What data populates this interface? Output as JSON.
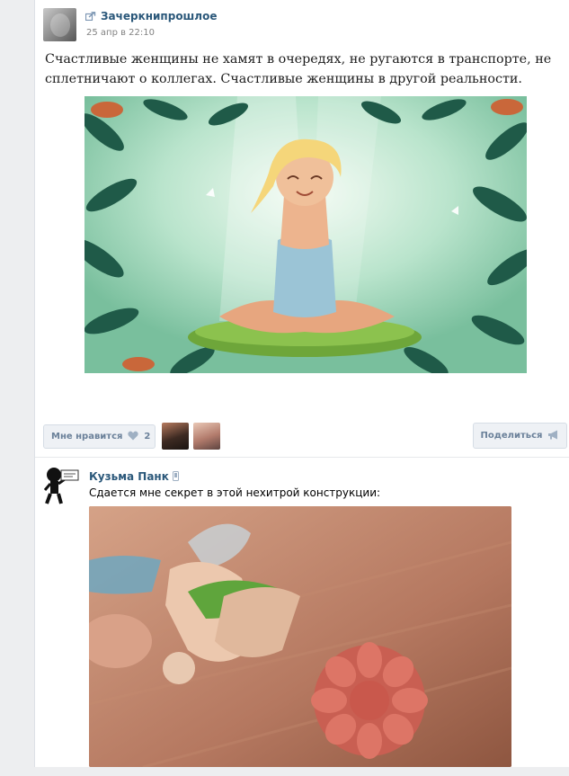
{
  "post": {
    "author": "Зачеркнипрошлое",
    "date": "25 апр в 22:10",
    "text": "Счастливые женщины не хамят в очередях, не ругаются в транспорте, не сплетничают о коллегах. Счастливые женщины в другой реальности.",
    "icons": {
      "repost": "repost-icon",
      "heart": "heart-icon",
      "megaphone": "megaphone-icon"
    }
  },
  "actions": {
    "like_label": "Мне нравится",
    "like_count": "2",
    "share_label": "Поделиться"
  },
  "comment": {
    "author": "Кузьма Панк",
    "text": "Сдается мне секрет в этой нехитрой конструкции:",
    "icons": {
      "mobile": "mobile-icon"
    }
  },
  "colors": {
    "link": "#2b587a",
    "button_text": "#6a8099",
    "button_bg": "#eef1f5",
    "page_bg": "#edeef0"
  }
}
